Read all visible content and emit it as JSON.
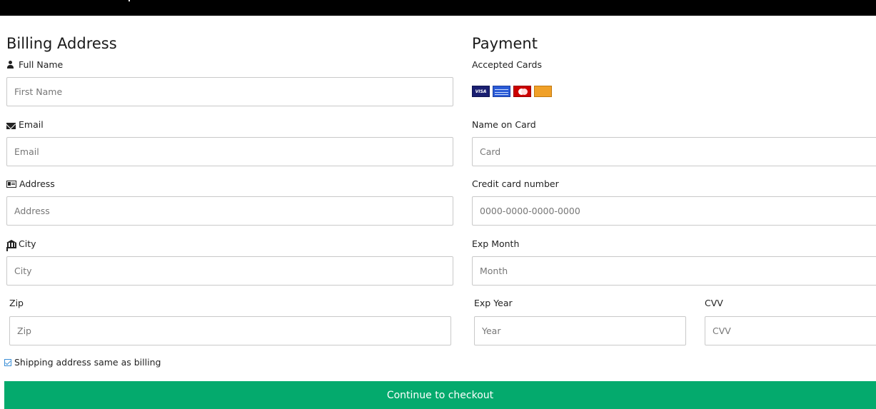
{
  "billing": {
    "title": "Billing Address",
    "full_name": {
      "label": "Full Name",
      "placeholder": "First Name",
      "icon": "user-icon"
    },
    "email": {
      "label": "Email",
      "placeholder": "Email",
      "icon": "envelope-icon"
    },
    "address": {
      "label": "Address",
      "placeholder": "Address",
      "icon": "address-card-icon"
    },
    "city": {
      "label": "City",
      "placeholder": "City",
      "icon": "institution-icon"
    },
    "zip": {
      "label": "Zip",
      "placeholder": "Zip"
    }
  },
  "payment": {
    "title": "Payment",
    "accepted_cards_label": "Accepted Cards",
    "cards": [
      "visa-card-icon",
      "amex-card-icon",
      "mastercard-icon",
      "discover-card-icon"
    ],
    "name_on_card": {
      "label": "Name on Card",
      "placeholder": "Card"
    },
    "card_number": {
      "label": "Credit card number",
      "placeholder": "0000-0000-0000-0000"
    },
    "exp_month": {
      "label": "Exp Month",
      "placeholder": "Month"
    },
    "exp_year": {
      "label": "Exp Year",
      "placeholder": "Year"
    },
    "cvv": {
      "label": "CVV",
      "placeholder": "CVV"
    }
  },
  "shipping_same": {
    "label": "Shipping address same as billing",
    "checked": true
  },
  "submit": {
    "label": "Continue to checkout"
  },
  "colors": {
    "accent": "#04aa6d",
    "topbar": "#000000",
    "checkbox": "#3b8fd6"
  }
}
